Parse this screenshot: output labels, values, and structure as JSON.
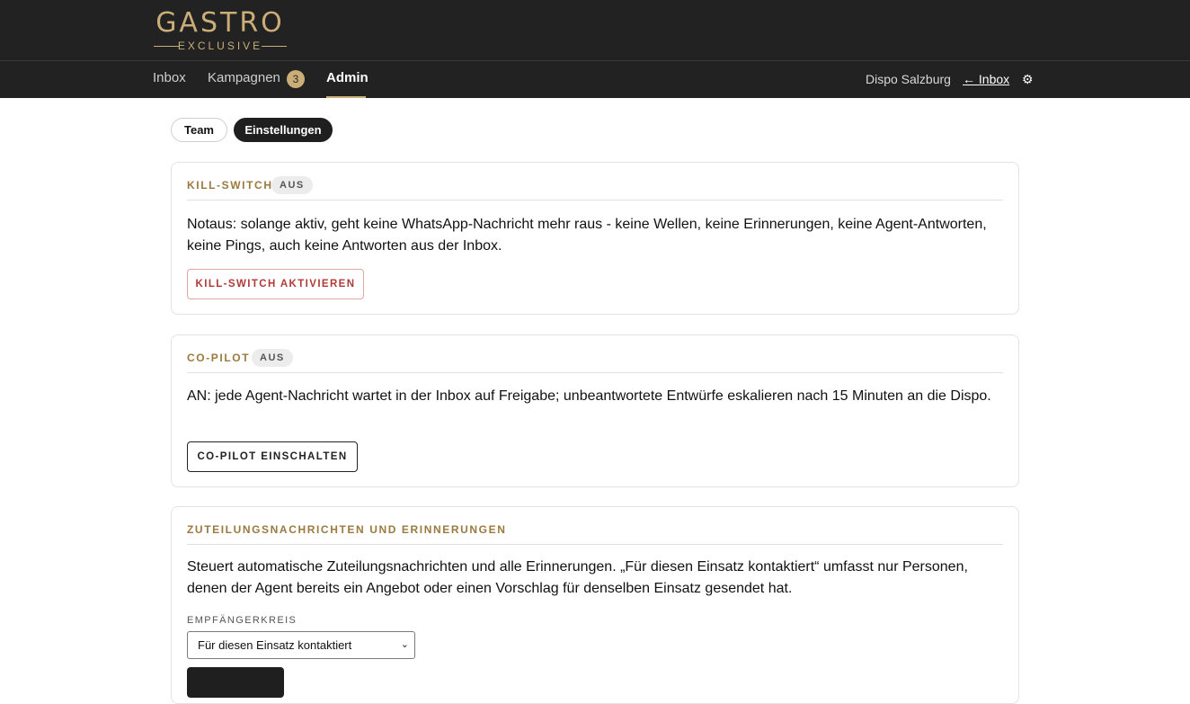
{
  "brand": {
    "name": "GASTRO",
    "tagline": "EXCLUSIVE"
  },
  "nav": {
    "items": [
      {
        "label": "Inbox"
      },
      {
        "label": "Kampagnen",
        "badge": "3"
      },
      {
        "label": "Admin",
        "active": true
      }
    ],
    "location": "Dispo Salzburg",
    "back_link": "← Inbox",
    "settings_icon": "gear-icon"
  },
  "tabs": [
    {
      "label": "Team",
      "active": false
    },
    {
      "label": "Einstellungen",
      "active": true
    }
  ],
  "cards": {
    "killswitch": {
      "title": "KILL-SWITCH",
      "status": "AUS",
      "text": "Notaus: solange aktiv, geht keine WhatsApp-Nachricht mehr raus - keine Wellen, keine Erinnerungen, keine Agent-Antworten, keine Pings, auch keine Antworten aus der Inbox.",
      "button": "KILL-SWITCH AKTIVIEREN"
    },
    "copilot": {
      "title": "CO-PILOT",
      "status": "AUS",
      "text": "AN: jede Agent-Nachricht wartet in der Inbox auf Freigabe; unbeantwortete Entwürfe eskalieren nach 15 Minuten an die Dispo.",
      "button": "CO-PILOT EINSCHALTEN"
    },
    "notifications": {
      "title": "ZUTEILUNGSNACHRICHTEN UND ERINNERUNGEN",
      "text": "Steuert automatische Zuteilungsnachrichten und alle Erinnerungen. „Für diesen Einsatz kontaktiert“ umfasst nur Personen, denen der Agent bereits ein Angebot oder einen Vorschlag für denselben Einsatz gesendet hat.",
      "field_label": "EMPFÄNGERKREIS",
      "select_value": "Für diesen Einsatz kontaktiert"
    }
  },
  "colors": {
    "accent": "#c9ae78",
    "header_bg": "#222222",
    "danger": "#b03a3a"
  }
}
